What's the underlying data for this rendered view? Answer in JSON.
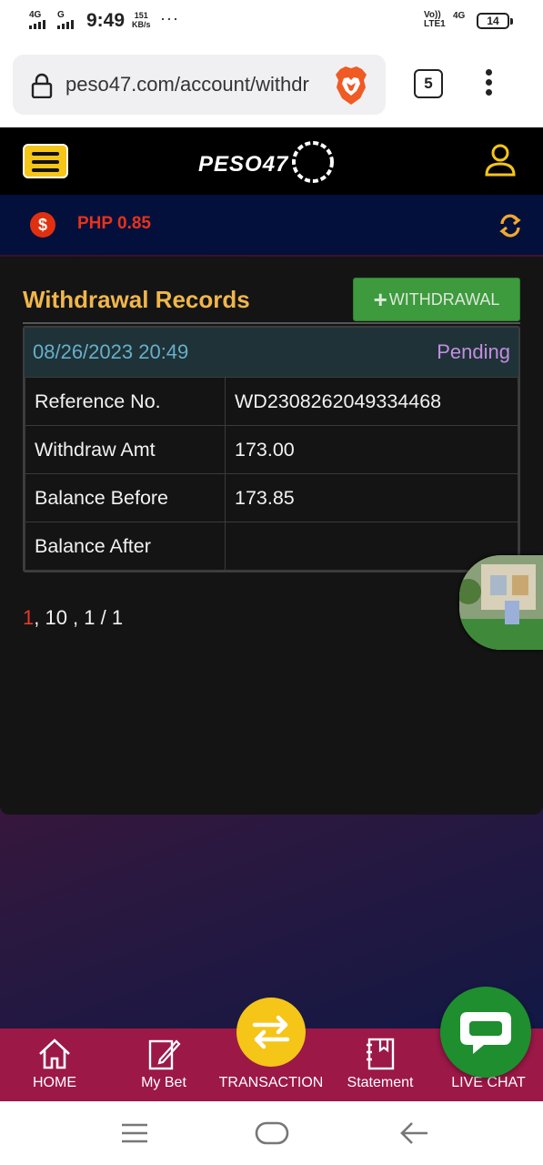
{
  "status_bar": {
    "network1": "4G",
    "network2": "G",
    "time": "9:49",
    "speed_value": "151",
    "speed_unit": "KB/s",
    "overflow": "···",
    "volte_top": "Vo))",
    "volte_bottom": "LTE1",
    "network3": "4G",
    "battery": "14"
  },
  "browser": {
    "url": "peso47.com/account/withdr",
    "tab_count": "5"
  },
  "header": {
    "logo_text": "PESO47"
  },
  "balance": {
    "currency_icon": "$",
    "text": "PHP 0.85"
  },
  "records": {
    "title": "Withdrawal Records",
    "add_button_icon": "+",
    "add_button_label": "WITHDRAWAL",
    "items": [
      {
        "datetime": "08/26/2023 20:49",
        "status": "Pending",
        "rows": [
          {
            "label": "Reference No.",
            "value": "WD2308262049334468"
          },
          {
            "label": "Withdraw Amt",
            "value": "173.00"
          },
          {
            "label": "Balance Before",
            "value": "173.85"
          },
          {
            "label": "Balance After",
            "value": ""
          }
        ]
      }
    ]
  },
  "pagination": {
    "current": "1",
    "rest": ", 10 , 1 / 1"
  },
  "bottom_nav": {
    "home": "HOME",
    "mybet": "My Bet",
    "transaction": "TRANSACTION",
    "statement": "Statement",
    "livechat": "LIVE CHAT"
  },
  "colors": {
    "accent_yellow": "#f5c518",
    "title_orange": "#f0b64a",
    "balance_red": "#e8321a",
    "nav_bg": "#9b1847",
    "status_pending": "#c28ee0"
  }
}
